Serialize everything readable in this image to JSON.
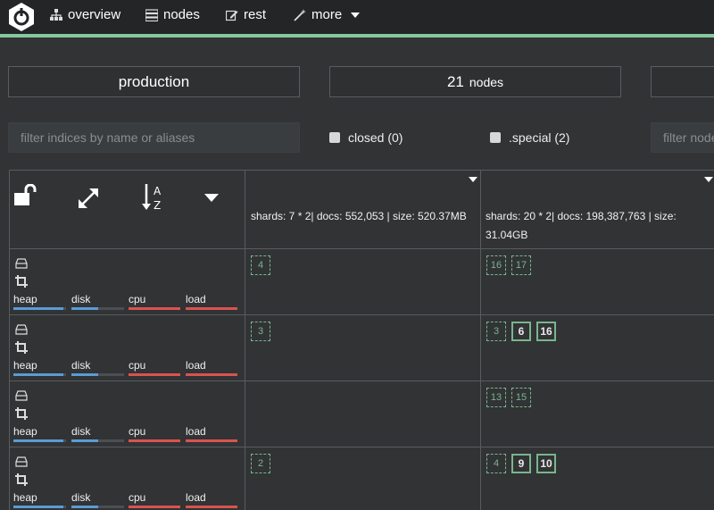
{
  "nav": {
    "overview": "overview",
    "nodes": "nodes",
    "rest": "rest",
    "more": "more"
  },
  "summary": {
    "cluster_name": "production",
    "node_count": "21",
    "node_unit": "nodes"
  },
  "filter": {
    "placeholder": "filter indices by name or aliases",
    "nodes_placeholder": "filter nodes",
    "closed_label": "closed (0)",
    "special_label": ".special (2)"
  },
  "indices": [
    {
      "stats_line1": "shards: 7 * 2| docs: 552,053 | size: 520.37MB",
      "stats_line2": ""
    },
    {
      "stats_line1": "shards: 20 * 2| docs: 198,387,763 | size:",
      "stats_line2": "31.04GB"
    }
  ],
  "metric_labels": {
    "heap": "heap",
    "disk": "disk",
    "cpu": "cpu",
    "load": "load"
  },
  "nodes": [
    {
      "heap": 0.95,
      "disk": 0.5,
      "cpu": 1.0,
      "load": 1.0,
      "shards_a": [
        {
          "n": "4",
          "primary": false
        }
      ],
      "shards_b": [
        {
          "n": "16",
          "primary": false
        },
        {
          "n": "17",
          "primary": false
        }
      ]
    },
    {
      "heap": 0.95,
      "disk": 0.5,
      "cpu": 1.0,
      "load": 1.0,
      "shards_a": [
        {
          "n": "3",
          "primary": false
        }
      ],
      "shards_b": [
        {
          "n": "3",
          "primary": false
        },
        {
          "n": "6",
          "primary": true
        },
        {
          "n": "16",
          "primary": true
        }
      ]
    },
    {
      "heap": 0.95,
      "disk": 0.5,
      "cpu": 1.0,
      "load": 1.0,
      "shards_a": [],
      "shards_b": [
        {
          "n": "13",
          "primary": false
        },
        {
          "n": "15",
          "primary": false
        }
      ]
    },
    {
      "heap": 0.95,
      "disk": 0.5,
      "cpu": 1.0,
      "load": 1.0,
      "shards_a": [
        {
          "n": "2",
          "primary": false
        }
      ],
      "shards_b": [
        {
          "n": "4",
          "primary": false
        },
        {
          "n": "9",
          "primary": true
        },
        {
          "n": "10",
          "primary": true
        }
      ]
    }
  ],
  "colors": {
    "accent": "#86c8a0",
    "heap_disk": "#5b9bd5",
    "cpu_load": "#d9534f",
    "shard": "#79b58e"
  }
}
